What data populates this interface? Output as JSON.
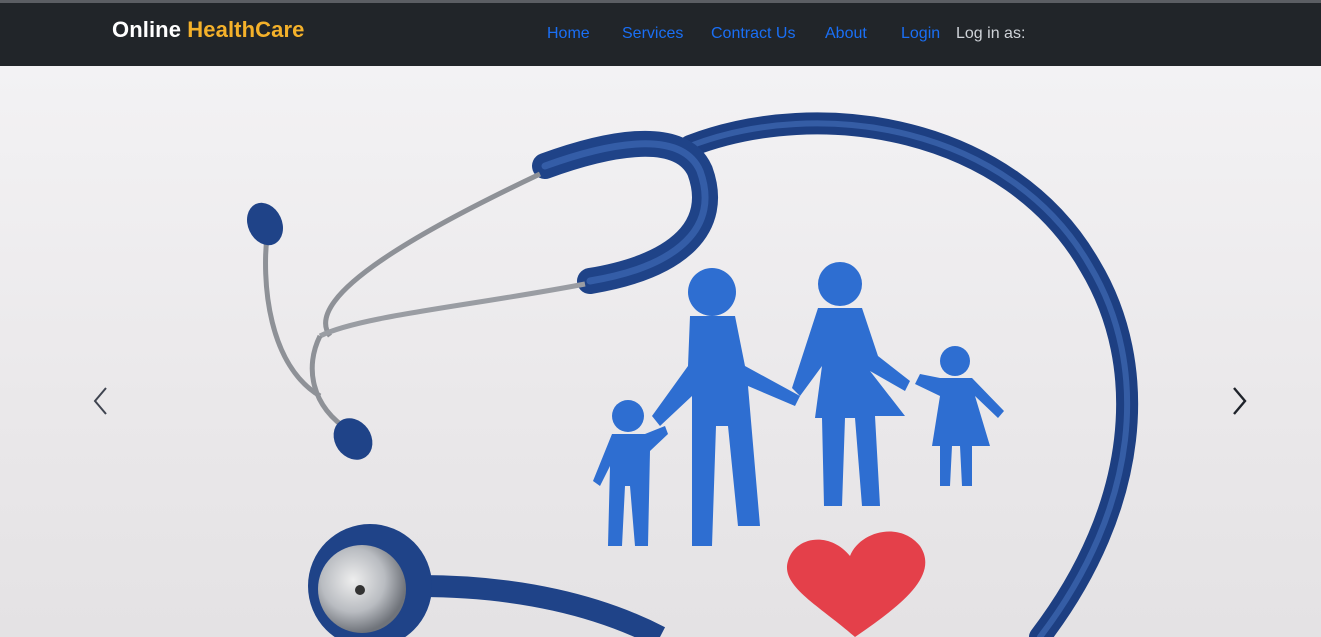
{
  "brand": {
    "part1": "Online",
    "part2": "HealthCare",
    "accent_color": "#f4b12a"
  },
  "nav": {
    "links": [
      "Home",
      "Services",
      "Contract Us",
      "About",
      "Login"
    ],
    "login_as": "Log in as:",
    "link_color": "#1a6ff5",
    "bar_color": "#212529"
  },
  "carousel": {
    "prev_icon": "chevron-left-icon",
    "next_icon": "chevron-right-icon"
  }
}
